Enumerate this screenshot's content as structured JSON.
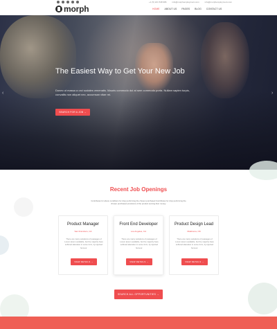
{
  "header": {
    "logo_text": "morph",
    "contacts": [
      "+1 (5) 221 548 986",
      "info@morphemployment.com",
      "info@morphemployment.com"
    ],
    "nav": [
      "HOME",
      "ABOUT US",
      "PAGES",
      "BLOG",
      "CONTACT US"
    ],
    "social_icons": [
      "twitter-icon",
      "facebook-icon",
      "google-icon",
      "linkedin-icon",
      "youtube-icon"
    ]
  },
  "hero": {
    "title": "The Easiest Way to Get Your New Job",
    "text": "Donec ut massa a orci sodales venenatis. Mauris commodo dui at sem commodo porta. Nullam sapien turpis, convallis non aliquet nec, accumsan vitae mi.",
    "button": "SEARCH FOR A JOB"
  },
  "jobs": {
    "title": "Recent Job Openings",
    "description": "Contributes for above conditions for drop performing the chosen purchased Contributes for drop performing the chosen purchased provisions of the product serving their money.",
    "cards": [
      {
        "title": "Product Manager",
        "location": "San Francisco, CA",
        "description": "There are many variations of passages of Lorem Ipsum available, but the majority have suffered alteration in some form, by injected humour.",
        "button": "VIEW DETAILS"
      },
      {
        "title": "Front End Developer",
        "location": "Los Angeles, CA",
        "description": "There are many variations of passages of Lorem Ipsum available, but the majority have suffered alteration in some form, by injected humour.",
        "button": "VIEW DETAILS"
      },
      {
        "title": "Product Design Lead",
        "location": "Oklahoma, OK",
        "description": "There are many variations of passages of Lorem Ipsum available, but the majority have suffered alteration in some form, by injected humour.",
        "button": "VIEW DETAILS"
      }
    ],
    "search_button": "SEARCH ALL OPPORTUNITIES"
  },
  "colors": {
    "accent": "#ef4d4f",
    "footer": "#ef5f55"
  }
}
